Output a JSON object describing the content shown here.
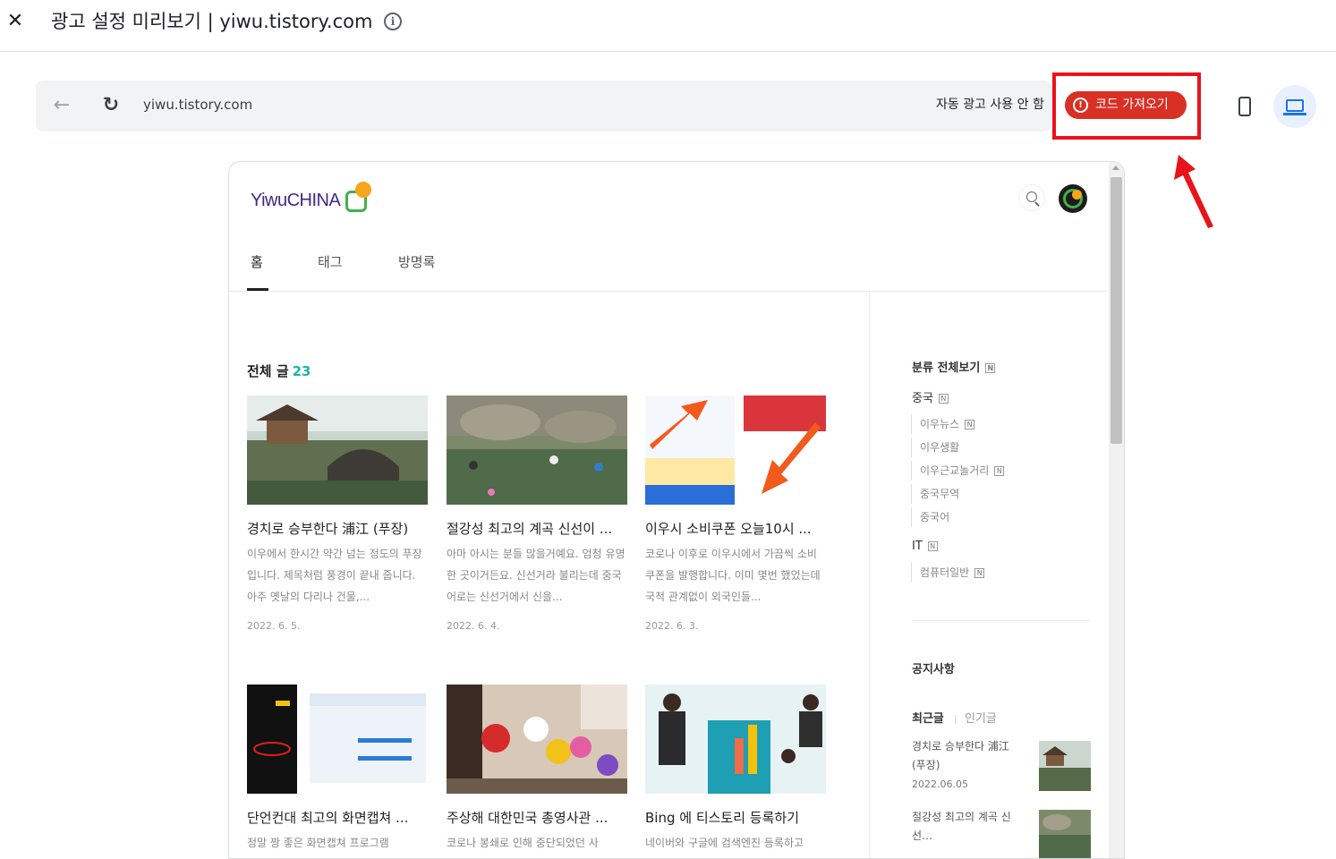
{
  "header": {
    "title": "광고 설정 미리보기 | yiwu.tistory.com",
    "close_glyph": "✕",
    "info_glyph": "i"
  },
  "toolbar": {
    "url": "yiwu.tistory.com",
    "auto_ads_status": "자동 광고 사용 안 함",
    "get_code_label": "코드 가져오기",
    "warn_glyph": "!",
    "back_glyph": "←",
    "reload_glyph": "↻"
  },
  "colors": {
    "accent_blue": "#1a73e8",
    "alert_red": "#d93025",
    "annotation_red": "#e8131b",
    "blog_teal": "#20b2aa"
  },
  "blog": {
    "logo_text": "YiwuCHINA",
    "nav": [
      "홈",
      "태그",
      "방명록"
    ],
    "all_posts_label": "전체 글",
    "post_count": "23",
    "posts": [
      {
        "title": "경치로 승부한다 浦江 (푸장)",
        "excerpt": "이우에서 한시간 약간 넘는 정도의 푸장 입니다. 제목처럼 풍경이 끝내 줍니다. 아주 옛날의 다리나 건물,...",
        "date": "2022. 6. 5."
      },
      {
        "title": "절강성 최고의 계곡 신선이 ...",
        "excerpt": "아마 아시는 분들 많을거예요. 엄청 유명한 곳이거든요. 신선거라 불리는데 중국어로는 신선거에서 신을...",
        "date": "2022. 6. 4."
      },
      {
        "title": "이우시 소비쿠폰 오늘10시 ...",
        "excerpt": "코로나 이후로 이우시에서 가끔씩 소비쿠폰을 발행합니다. 이미 몇번 했었는데 국적 관계없이 외국인들...",
        "date": "2022. 6. 3."
      },
      {
        "title": "단언컨대 최고의 화면캡쳐 ...",
        "excerpt": "정말 짱 좋은 화면캡쳐 프로그램",
        "date": ""
      },
      {
        "title": "주상해 대한민국 총영사관 ...",
        "excerpt": "코로나 봉쇄로 인해 중단되었던 사",
        "date": ""
      },
      {
        "title": "Bing 에 티스토리 등록하기",
        "excerpt": "네이버와 구글에 검색엔진 등록하고",
        "date": ""
      }
    ],
    "sidebar": {
      "category_head": "분류 전체보기",
      "new_badge": "N",
      "cat_china": "중국",
      "sub_news": "이우뉴스",
      "sub_life": "이우생활",
      "sub_street": "이우근교놀거리",
      "sub_trade": "중국무역",
      "sub_lang": "중국어",
      "cat_it": "IT",
      "sub_pc": "컴퓨터일반",
      "notice_head": "공지사항",
      "tab_recent": "최근글",
      "tab_sep": "|",
      "tab_popular": "인기글",
      "recent": [
        {
          "title": "경치로 승부한다 浦江 (푸장)",
          "date": "2022.06.05"
        },
        {
          "title": "절강성 최고의 계곡 신선…",
          "date": ""
        }
      ]
    }
  }
}
